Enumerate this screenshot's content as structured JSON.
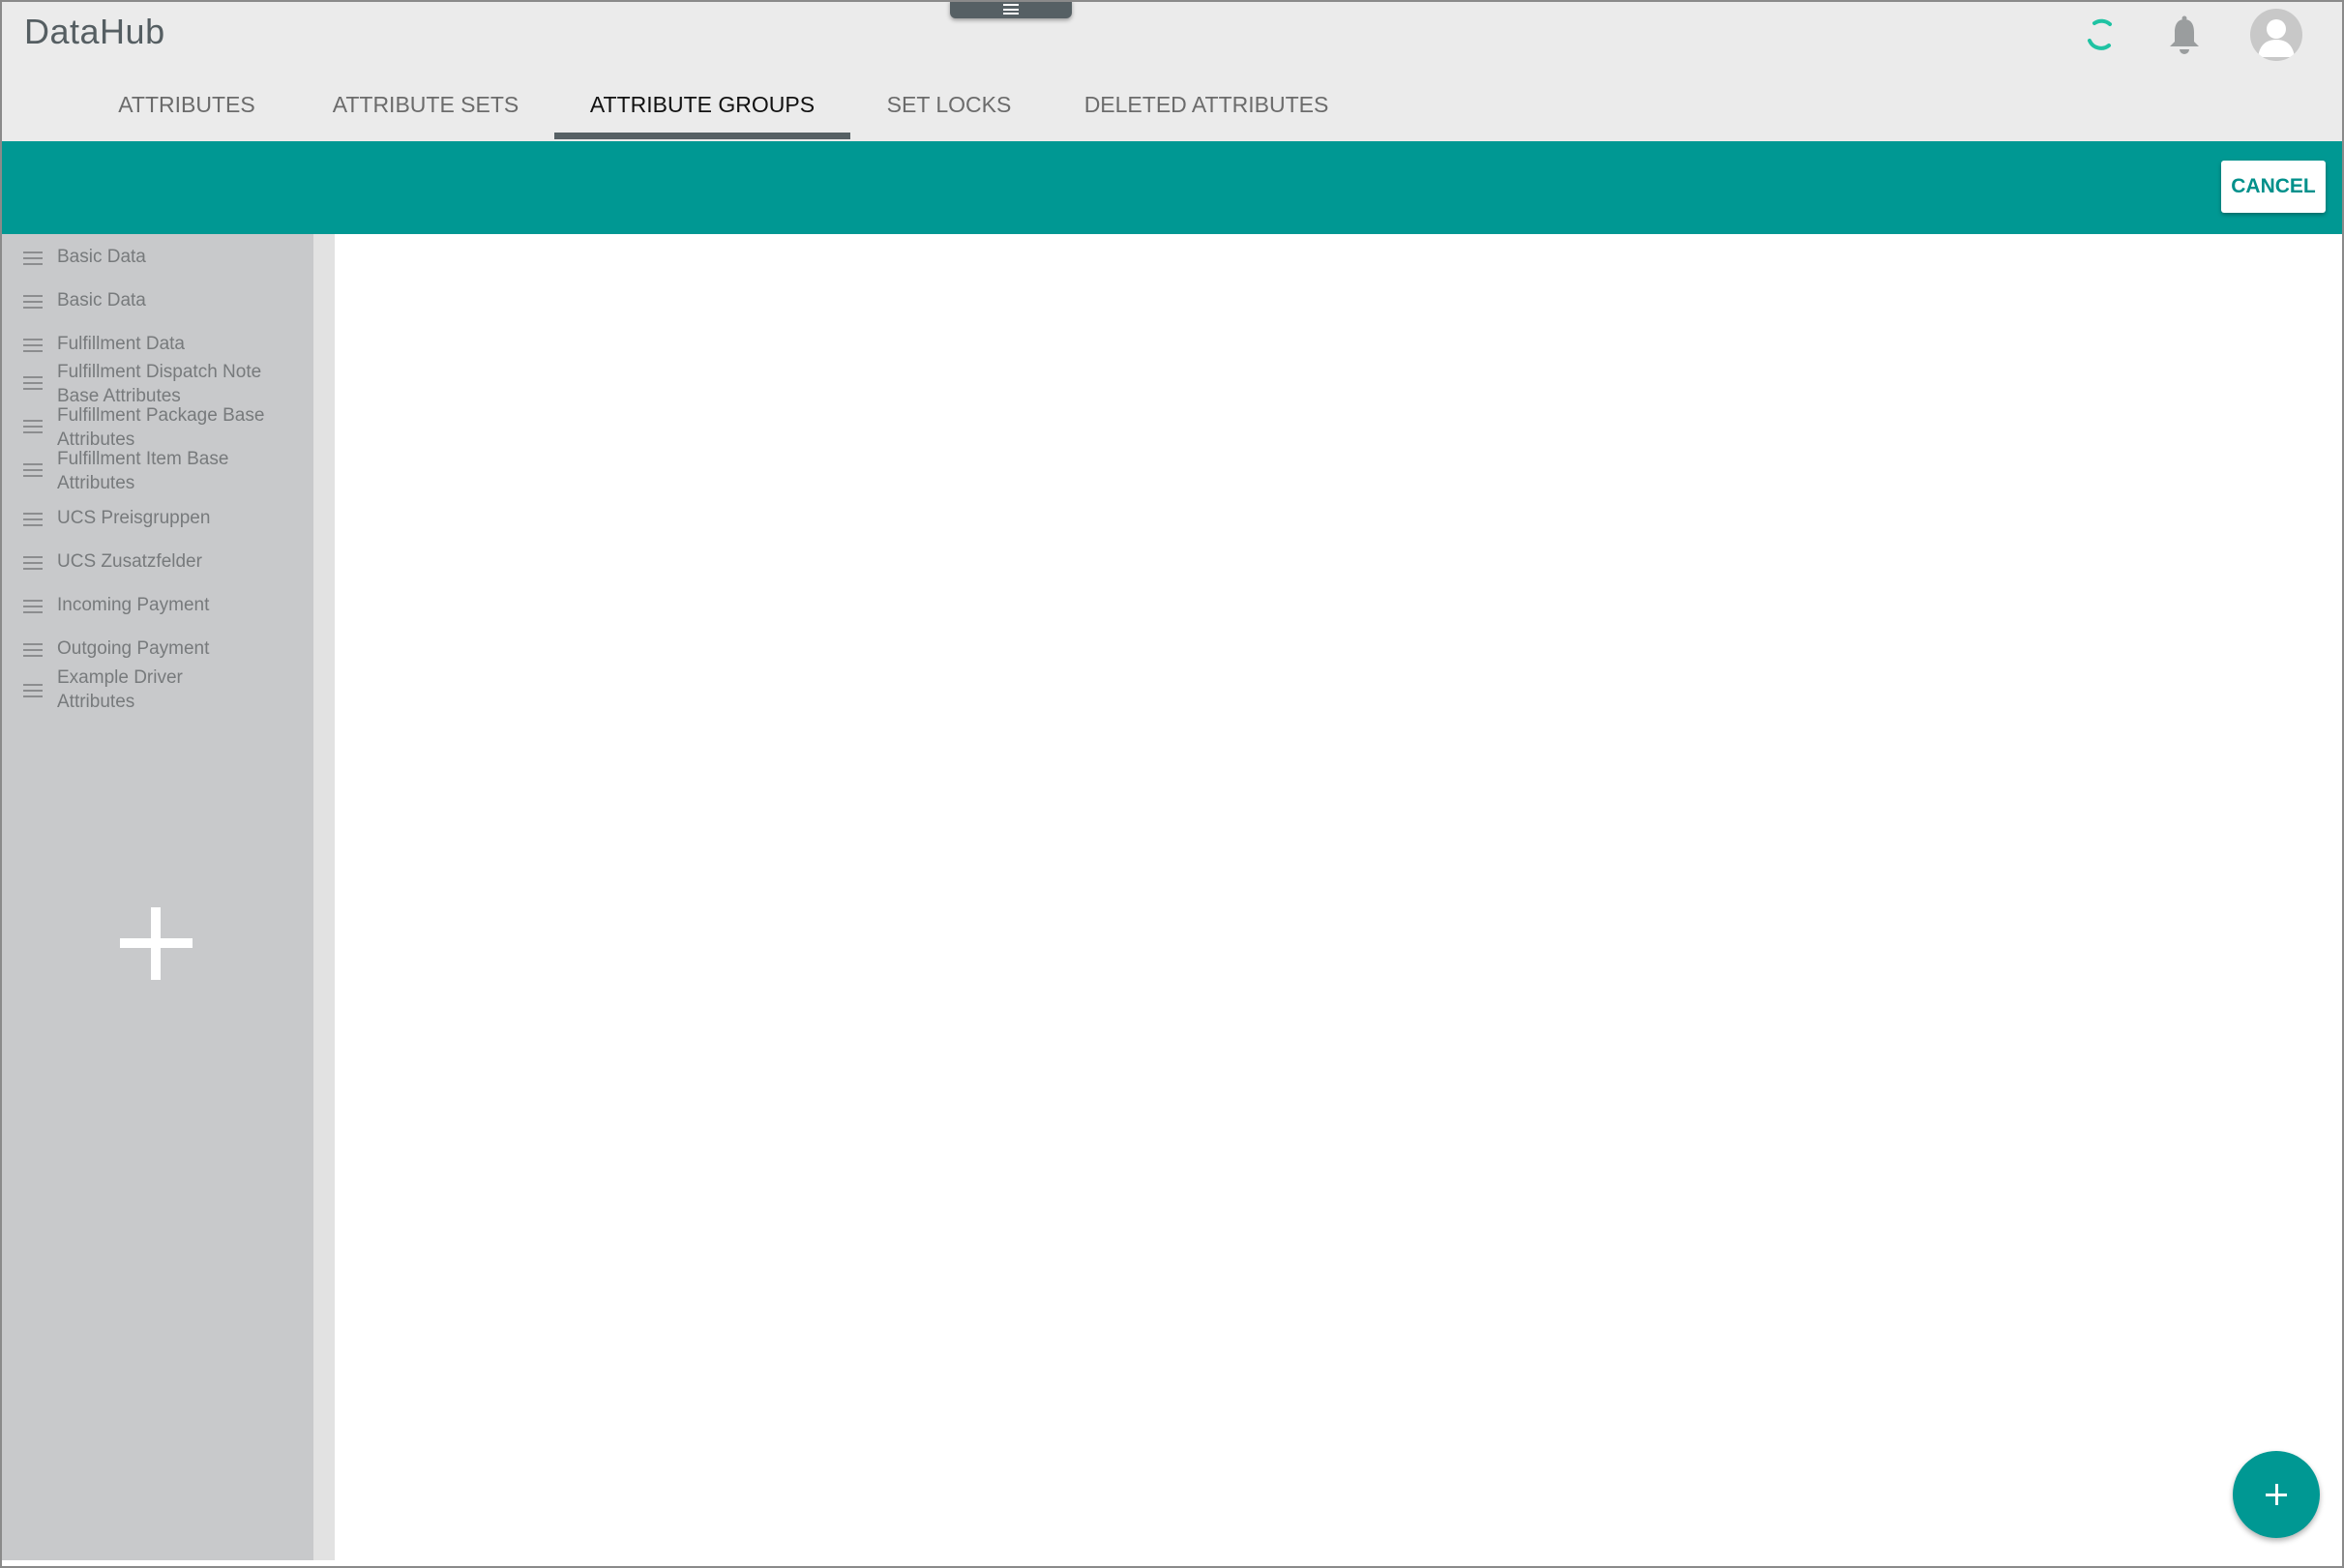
{
  "app": {
    "title": "DataHub"
  },
  "header": {
    "icons": {
      "spinner": "loading-spinner-icon",
      "notifications": "bell-icon",
      "user": "avatar-icon",
      "menu_handle": "menu-icon"
    }
  },
  "tabs": [
    {
      "label": "ATTRIBUTES",
      "active": false
    },
    {
      "label": "ATTRIBUTE SETS",
      "active": false
    },
    {
      "label": "ATTRIBUTE GROUPS",
      "active": true
    },
    {
      "label": "SET LOCKS",
      "active": false
    },
    {
      "label": "DELETED ATTRIBUTES",
      "active": false
    }
  ],
  "toolbar": {
    "cancel_label": "CANCEL"
  },
  "sidebar": {
    "items": [
      {
        "label": "Basic Data"
      },
      {
        "label": "Basic Data"
      },
      {
        "label": "Fulfillment Data"
      },
      {
        "label": "Fulfillment Dispatch Note Base Attributes"
      },
      {
        "label": "Fulfillment Package Base Attributes"
      },
      {
        "label": "Fulfillment Item Base Attributes"
      },
      {
        "label": "UCS Preisgruppen"
      },
      {
        "label": "UCS Zusatzfelder"
      },
      {
        "label": "Incoming Payment"
      },
      {
        "label": "Outgoing Payment"
      },
      {
        "label": "Example Driver Attributes"
      }
    ],
    "add_icon": "plus-icon"
  },
  "fab": {
    "icon": "plus-icon"
  },
  "colors": {
    "accent": "#009893",
    "header_bg": "#ebebeb",
    "sidebar_bg": "#c8c9cb",
    "spinner": "#1fc3a3"
  }
}
